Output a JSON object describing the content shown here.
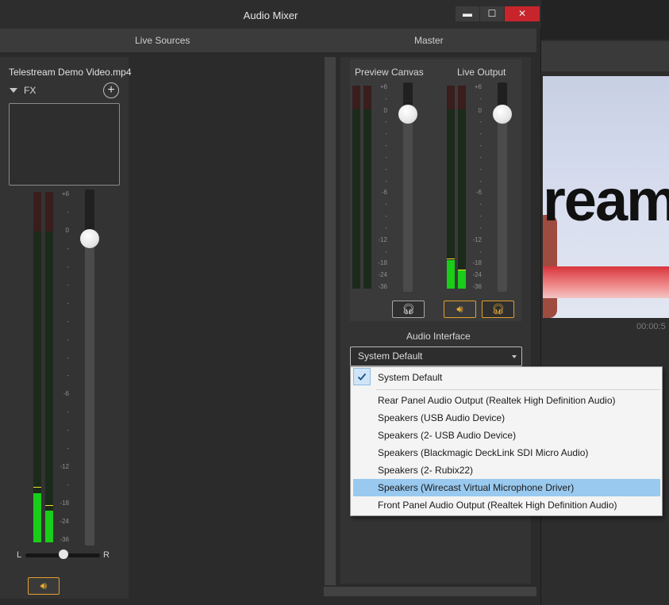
{
  "window": {
    "title": "Audio Mixer",
    "controls": {
      "minimize": "▬",
      "maximize": "☐",
      "close": "✕"
    }
  },
  "section_tabs": {
    "live_sources": "Live Sources",
    "master": "Master"
  },
  "source": {
    "name": "Telestream Demo Video.mp4",
    "fx_label": "FX",
    "fx_add_symbol": "+",
    "meter_scale": [
      "+6",
      "-",
      "0",
      "-",
      "-",
      "-",
      "-",
      "-",
      "-",
      "-",
      "-",
      "-6",
      "-",
      "-",
      "-",
      "-12",
      "-",
      "-18",
      "-24",
      "-36"
    ],
    "left_level": 0.14,
    "right_level": 0.09,
    "fader_level": 0.83,
    "pan_left": "L",
    "pan_right": "R",
    "pan_value": 0.5,
    "speaker_icon": "speaker-icon"
  },
  "master": {
    "preview_canvas_label": "Preview Canvas",
    "live_output_label": "Live Output",
    "meter_scale": [
      "+6",
      "-",
      "0",
      "-",
      "-",
      "-",
      "-",
      "-",
      "-",
      "-6",
      "-",
      "-",
      "-",
      "-12",
      "-",
      "-18",
      "-24",
      "-36"
    ],
    "preview_levels": [
      0.0,
      0.0
    ],
    "live_levels": [
      0.14,
      0.09
    ],
    "preview_fader_level": 0.85,
    "live_fader_level": 0.85,
    "preview_monitor_icon": "headphones-icon",
    "live_speaker_icon": "speaker-icon",
    "live_monitor_icon": "headphones-icon"
  },
  "audio_interface": {
    "label": "Audio Interface",
    "selected": "System Default",
    "options": [
      {
        "label": "System Default",
        "checked": true
      },
      {
        "label": "Rear Panel Audio Output (Realtek High Definition Audio)"
      },
      {
        "label": "Speakers (USB Audio Device)"
      },
      {
        "label": "Speakers (2- USB Audio Device)"
      },
      {
        "label": "Speakers (Blackmagic DeckLink SDI Micro Audio)"
      },
      {
        "label": "Speakers (2- Rubix22)"
      },
      {
        "label": "Speakers (Wirecast Virtual Microphone Driver)",
        "highlighted": true
      },
      {
        "label": "Front Panel Audio Output (Realtek High Definition Audio)"
      }
    ]
  },
  "background_app": {
    "preview_text": "ream",
    "timecode": "00:00:5"
  },
  "colors": {
    "accent": "#e3a12b",
    "meter_green": "#19cd19",
    "close_red": "#c7242b",
    "menu_highlight": "#99c9ef"
  }
}
